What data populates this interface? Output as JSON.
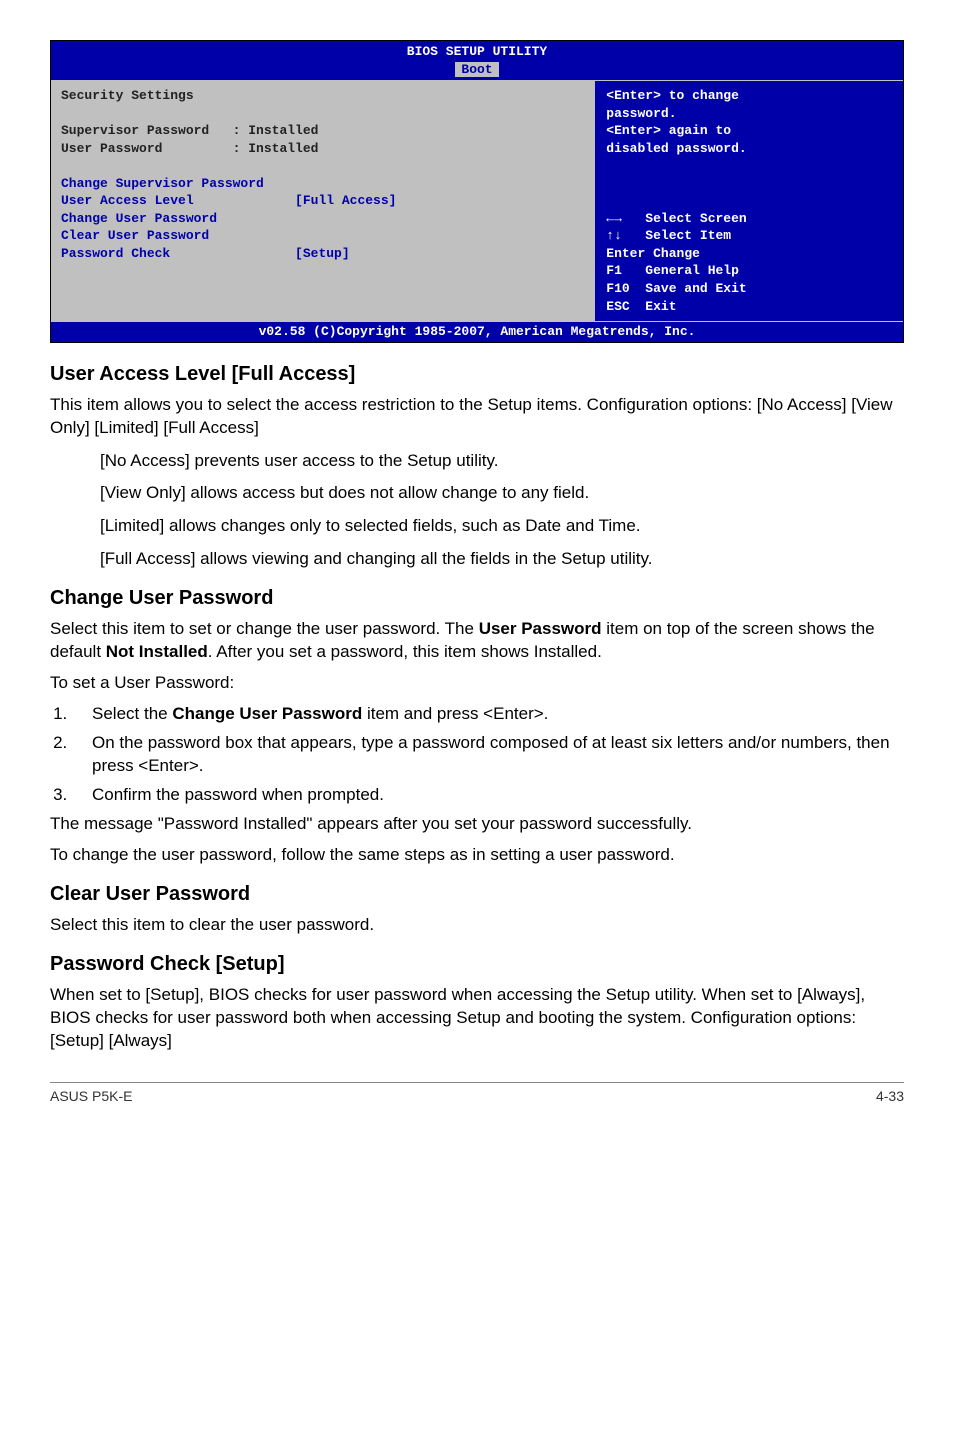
{
  "bios": {
    "title": "BIOS SETUP UTILITY",
    "active_tab": "Boot",
    "main": {
      "heading": "Security Settings",
      "sup_label": "Supervisor Password",
      "sup_val": ": Installed",
      "usr_label": "User Password",
      "usr_val": ": Installed",
      "item1": "Change Supervisor Password",
      "item2": "User Access Level",
      "item2_val": "[Full Access]",
      "item3": "Change User Password",
      "item4": "Clear User Password",
      "item5": "Password Check",
      "item5_val": "[Setup]"
    },
    "help": {
      "l1": "<Enter> to change",
      "l2": "password.",
      "l3": "<Enter> again to",
      "l4": "disabled password."
    },
    "nav": {
      "n1a": "←→",
      "n1b": "   Select Screen",
      "n2a": "↑↓",
      "n2b": "   Select Item",
      "n3a": "Enter",
      "n3b": "Change",
      "n4a": "F1",
      "n4b": "   General Help",
      "n5a": "F10",
      "n5b": "  Save and Exit",
      "n6a": "ESC",
      "n6b": "  Exit"
    },
    "footer": "v02.58 (C)Copyright 1985-2007, American Megatrends, Inc."
  },
  "sec_ual": {
    "heading": "User Access Level [Full Access]",
    "p1": "This item allows you to select the access restriction to the Setup items. Configuration options: [No Access] [View Only] [Limited] [Full Access]",
    "b1": "[No Access] prevents user access to the Setup utility.",
    "b2": "[View Only] allows access but does not allow change to any field.",
    "b3": "[Limited] allows changes only to selected fields, such as Date and Time.",
    "b4": "[Full Access] allows viewing and changing all the fields in the Setup utility."
  },
  "sec_cup": {
    "heading": "Change User Password",
    "p1_a": "Select this item to set or change the user password. The ",
    "p1_b": "User Password",
    "p1_c": " item on top of the screen shows the default ",
    "p1_d": "Not Installed",
    "p1_e": ". After you set a password, this item shows Installed.",
    "p2": "To set a User Password:",
    "s1_a": "Select the ",
    "s1_b": "Change User Password",
    "s1_c": " item and press <Enter>.",
    "s2": "On the password box that appears, type a password composed of at least six letters and/or numbers, then press <Enter>.",
    "s3": "Confirm the password when prompted.",
    "p3": "The message \"Password Installed\" appears after you set your password successfully.",
    "p4": "To change the user password, follow the same steps as in setting a user password."
  },
  "sec_clr": {
    "heading": "Clear User Password",
    "p1": "Select this item to clear the user password."
  },
  "sec_pc": {
    "heading": "Password Check [Setup]",
    "p1": "When set to [Setup], BIOS checks for user password when accessing the Setup utility. When set to [Always], BIOS checks for user password both when accessing Setup and booting the system. Configuration options: [Setup] [Always]"
  },
  "footer": {
    "left": "ASUS P5K-E",
    "right": "4-33"
  }
}
